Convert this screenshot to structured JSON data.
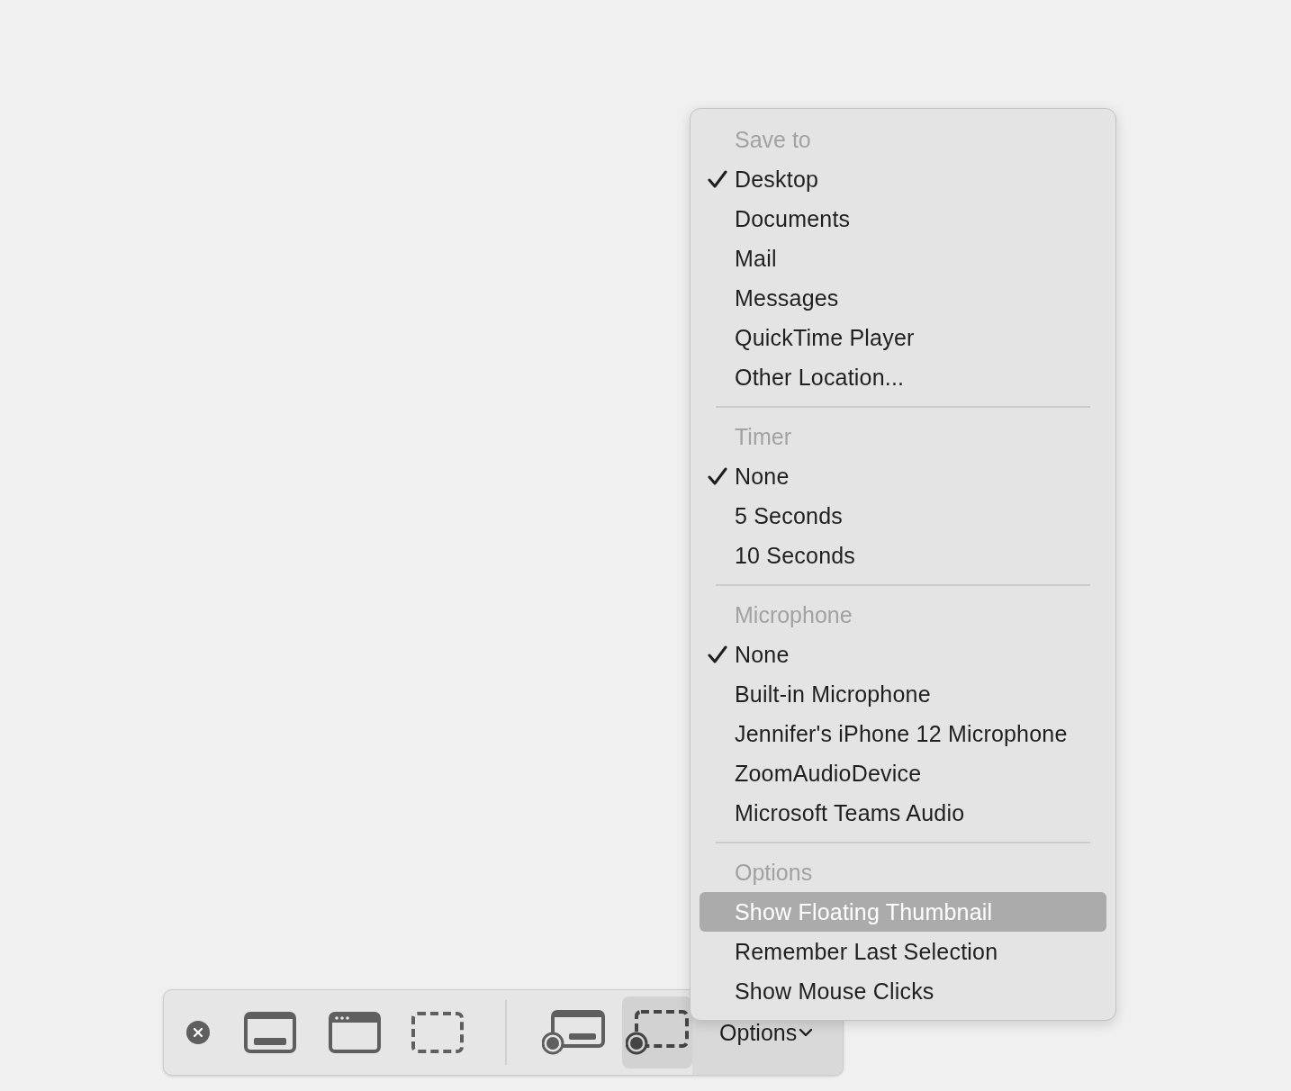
{
  "toolbar": {
    "tools": [
      {
        "kind": "close",
        "selected": false
      },
      {
        "kind": "capture-screen",
        "selected": false
      },
      {
        "kind": "capture-window",
        "selected": false
      },
      {
        "kind": "capture-selection",
        "selected": false
      },
      {
        "kind": "separator"
      },
      {
        "kind": "record-screen",
        "selected": false
      },
      {
        "kind": "record-selection",
        "selected": true
      }
    ],
    "options_button": {
      "label": "Options",
      "expanded": true
    }
  },
  "menu": {
    "sections": [
      {
        "heading": "Save to",
        "items": [
          {
            "label": "Desktop",
            "checked": true,
            "highlighted": false
          },
          {
            "label": "Documents",
            "checked": false,
            "highlighted": false
          },
          {
            "label": "Mail",
            "checked": false,
            "highlighted": false
          },
          {
            "label": "Messages",
            "checked": false,
            "highlighted": false
          },
          {
            "label": "QuickTime Player",
            "checked": false,
            "highlighted": false
          },
          {
            "label": "Other Location...",
            "checked": false,
            "highlighted": false
          }
        ]
      },
      {
        "heading": "Timer",
        "items": [
          {
            "label": "None",
            "checked": true,
            "highlighted": false
          },
          {
            "label": "5 Seconds",
            "checked": false,
            "highlighted": false
          },
          {
            "label": "10 Seconds",
            "checked": false,
            "highlighted": false
          }
        ]
      },
      {
        "heading": "Microphone",
        "items": [
          {
            "label": "None",
            "checked": true,
            "highlighted": false
          },
          {
            "label": "Built-in Microphone",
            "checked": false,
            "highlighted": false
          },
          {
            "label": "Jennifer's iPhone 12 Microphone",
            "checked": false,
            "highlighted": false
          },
          {
            "label": "ZoomAudioDevice",
            "checked": false,
            "highlighted": false
          },
          {
            "label": "Microsoft Teams Audio",
            "checked": false,
            "highlighted": false
          }
        ]
      },
      {
        "heading": "Options",
        "items": [
          {
            "label": "Show Floating Thumbnail",
            "checked": false,
            "highlighted": true
          },
          {
            "label": "Remember Last Selection",
            "checked": false,
            "highlighted": false
          },
          {
            "label": "Show Mouse Clicks",
            "checked": false,
            "highlighted": false
          }
        ]
      }
    ]
  }
}
